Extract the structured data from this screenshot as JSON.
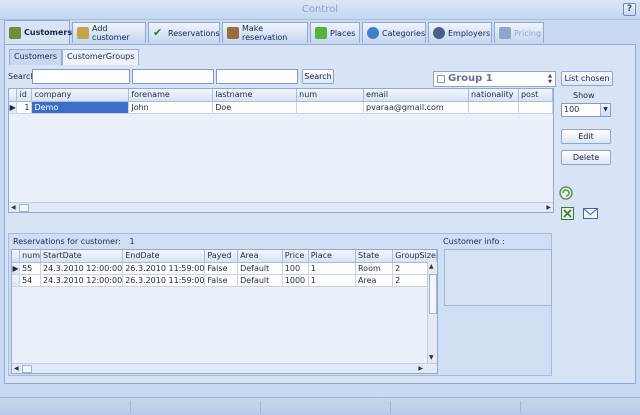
{
  "window": {
    "title": "Control",
    "help": "?"
  },
  "tabs": [
    {
      "label": "Customers",
      "icon": "customers-icon",
      "color": "#6c8f3d"
    },
    {
      "label": "Add customer",
      "icon": "add-customer-icon",
      "color": "#c7a34a"
    },
    {
      "label": "Reservations",
      "icon": "reservations-icon",
      "color": "#2e7d32"
    },
    {
      "label": "Make reservation",
      "icon": "make-reservation-icon",
      "color": "#9a6b3f"
    },
    {
      "label": "Places",
      "icon": "places-icon",
      "color": "#57b33e"
    },
    {
      "label": "Categories",
      "icon": "categories-icon",
      "color": "#3f7fc9"
    },
    {
      "label": "Employers",
      "icon": "employers-icon",
      "color": "#4b5f8a"
    },
    {
      "label": "Pricing",
      "icon": "pricing-icon",
      "color": "#8fa6cc"
    }
  ],
  "subtabs": [
    "Customers",
    "CustomerGroups"
  ],
  "search": {
    "label": "Search",
    "button": "Search",
    "field1": "",
    "field2": "",
    "field3": "",
    "field4": ""
  },
  "group": {
    "value": "Group 1"
  },
  "customers": {
    "columns": [
      "id",
      "company",
      "forename",
      "lastname",
      "num",
      "email",
      "nationality",
      "post"
    ],
    "rows": [
      {
        "id": "1",
        "company": "Demo",
        "forename": "John",
        "lastname": "Doe",
        "num": "",
        "email": "pvaraa@gmail.com",
        "nationality": "",
        "post": ""
      }
    ]
  },
  "side": {
    "list_chosen": "List chosen",
    "show_label": "Show",
    "show_value": "100",
    "edit": "Edit",
    "delete": "Delete"
  },
  "reservations": {
    "label": "Reservations for customer:",
    "count": "1",
    "columns": [
      "num",
      "StartDate",
      "EndDate",
      "Payed",
      "Area",
      "Price",
      "Place",
      "State",
      "GroupSize"
    ],
    "rows": [
      {
        "num": "55",
        "start": "24.3.2010 12:00:00",
        "end": "26.3.2010 11:59:00",
        "payed": "False",
        "area": "Default",
        "price": "100",
        "place": "1",
        "state": "Room",
        "size": "2"
      },
      {
        "num": "54",
        "start": "24.3.2010 12:00:00",
        "end": "26.3.2010 11:59:00",
        "payed": "False",
        "area": "Default",
        "price": "1000",
        "place": "1",
        "state": "Area",
        "size": "2"
      }
    ]
  },
  "info": {
    "label": "Customer info :"
  }
}
